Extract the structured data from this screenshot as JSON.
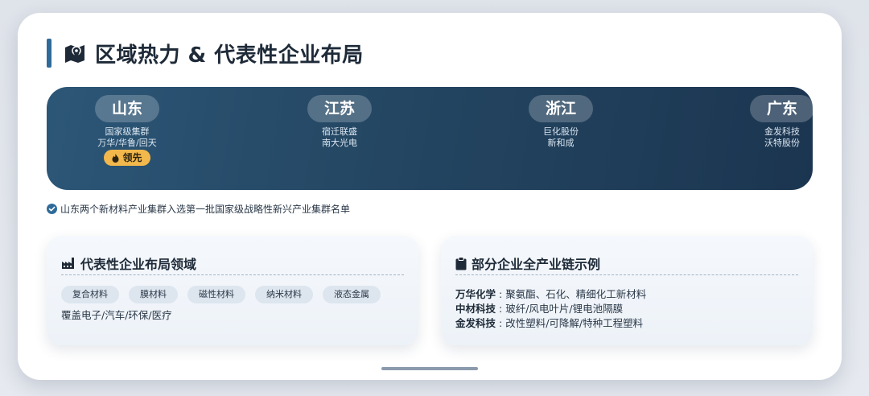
{
  "header": {
    "title": "区域热力 & 代表性企业布局"
  },
  "regions": [
    {
      "name": "山东",
      "lines": [
        "国家级集群",
        "万华/华鲁/回天"
      ],
      "badge": "领先"
    },
    {
      "name": "江苏",
      "lines": [
        "宿迁联盛",
        "南大光电"
      ]
    },
    {
      "name": "浙江",
      "lines": [
        "巨化股份",
        "新和成"
      ]
    },
    {
      "name": "广东",
      "lines": [
        "金发科技",
        "沃特股份"
      ]
    }
  ],
  "note": "山东两个新材料产业集群入选第一批国家级战略性新兴产业集群名单",
  "layout_panel": {
    "title": "代表性企业布局领域",
    "tags": [
      "复合材料",
      "膜材料",
      "磁性材料",
      "纳米材料",
      "液态金属"
    ],
    "coverage": "覆盖电子/汽车/环保/医疗"
  },
  "chain_panel": {
    "title": "部分企业全产业链示例",
    "rows": [
      {
        "company": "万华化学",
        "sep": " : ",
        "desc": "聚氨酯、石化、精细化工新材料"
      },
      {
        "company": "中材科技",
        "sep": " : ",
        "desc": "玻纤/风电叶片/锂电池隔膜"
      },
      {
        "company": "金发科技",
        "sep": " : ",
        "desc": "改性塑料/可降解/特种工程塑料"
      }
    ]
  },
  "colors": {
    "accent": "#2f6b9a",
    "banner": "#244662",
    "badge": "#f2b84b"
  },
  "icons": {
    "title": "map-icon",
    "note": "check-circle-icon",
    "layout": "factory-icon",
    "chain": "clipboard-icon",
    "badge": "fire-icon"
  }
}
